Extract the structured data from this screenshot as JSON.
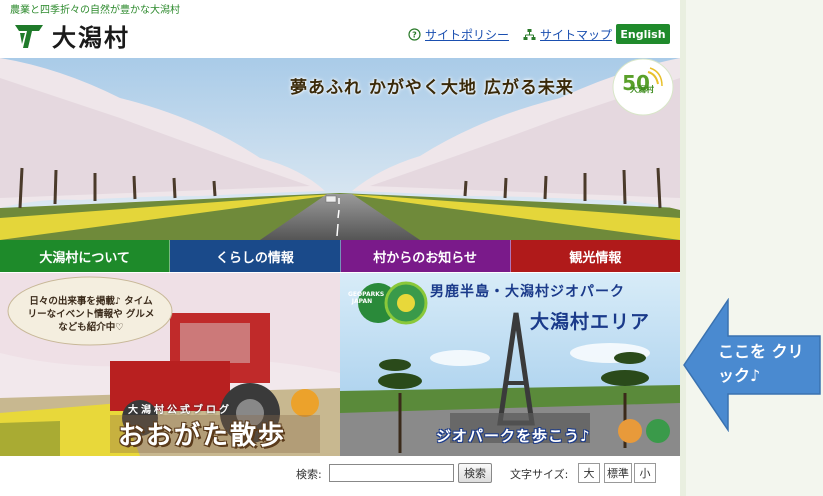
{
  "header": {
    "tagline": "農業と四季折々の自然が豊かな大潟村",
    "logo_text": "大潟村",
    "links": [
      {
        "label": "サイトポリシー",
        "icon": "question-circle-icon"
      },
      {
        "label": "サイトマップ",
        "icon": "sitemap-icon"
      }
    ],
    "english_label": "English"
  },
  "hero": {
    "slogan": "夢あふれ かがやく大地 広がる未来",
    "badge_text": "大潟村"
  },
  "nav": [
    {
      "label": "大潟村について",
      "color": "#1e8a2a"
    },
    {
      "label": "くらしの情報",
      "color": "#1a4a8a"
    },
    {
      "label": "村からのお知らせ",
      "color": "#7a1a8a"
    },
    {
      "label": "観光情報",
      "color": "#b01a1a"
    }
  ],
  "banners": {
    "blog_bubble": "日々の出来事を掲載♪ タイムリーなイベント情報や グルメなども紹介中♡",
    "blog_sub": "大潟村公式ブログ",
    "blog_title": "おおがた散歩",
    "geo_logo": "GEOPARKS JAPAN",
    "geo_title1": "男鹿半島・大潟村ジオパーク",
    "geo_title2": "大潟村エリア",
    "geo_walk": "ジオパークを歩こう♪"
  },
  "search": {
    "label": "検索:",
    "value": "",
    "button": "検索",
    "font_size_label": "文字サイズ:",
    "sizes": [
      "大",
      "標準",
      "小"
    ]
  },
  "callout": {
    "text": "ここを クリック♪",
    "color": "#4a8ad0"
  }
}
